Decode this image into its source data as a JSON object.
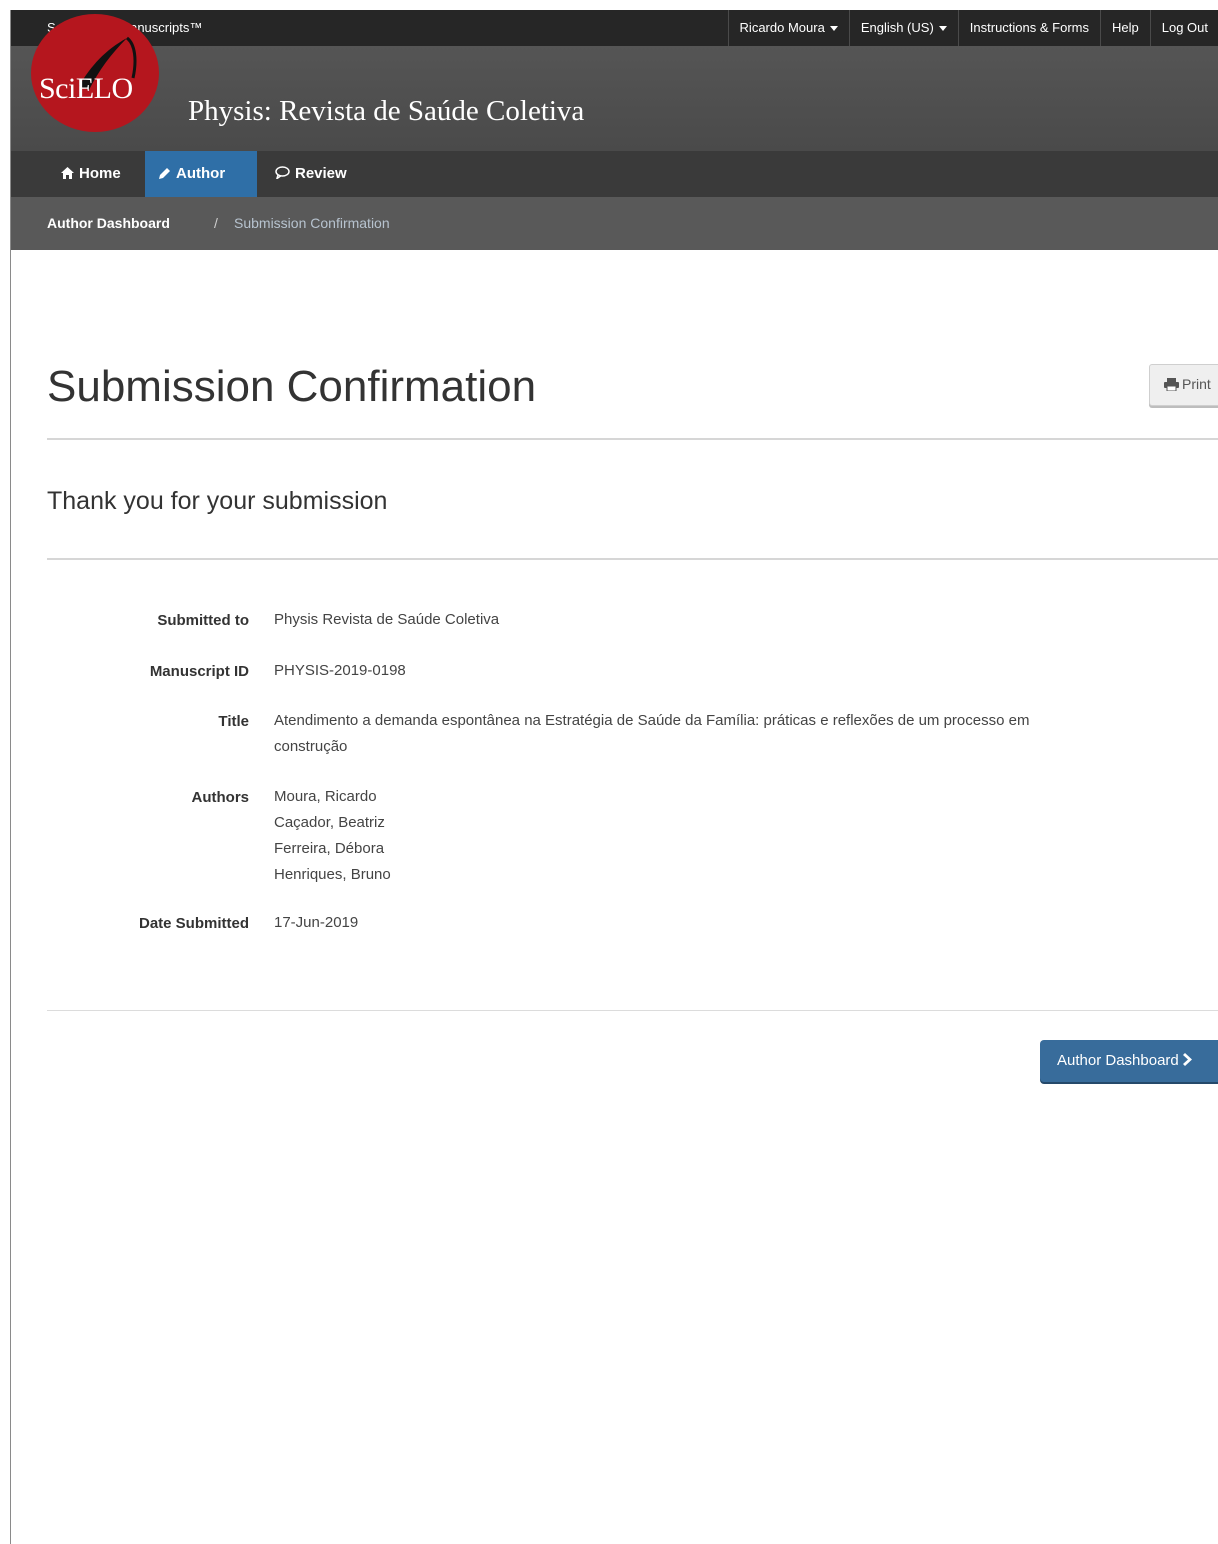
{
  "topbar": {
    "brand": "ScholarOne Manuscripts™",
    "user": "Ricardo Moura",
    "language": "English (US)",
    "instructions": "Instructions & Forms",
    "help": "Help",
    "logout": "Log Out"
  },
  "header": {
    "logo_text": "SciELO",
    "journal_title": "Physis: Revista de Saúde Coletiva"
  },
  "nav": {
    "home": "Home",
    "author": "Author",
    "review": "Review",
    "active": "Author"
  },
  "breadcrumb": {
    "link": "Author Dashboard",
    "separator": "/",
    "current": "Submission Confirmation"
  },
  "page": {
    "title": "Submission Confirmation",
    "print_label": "Print",
    "subtitle": "Thank you for your submission"
  },
  "details": {
    "submitted_to_label": "Submitted to",
    "submitted_to": "Physis Revista de Saúde Coletiva",
    "manuscript_id_label": "Manuscript ID",
    "manuscript_id": "PHYSIS-2019-0198",
    "title_label": "Title",
    "title_line1": "Atendimento a demanda espontânea na Estratégia de Saúde da Família: práticas e reflexões de um processo em",
    "title_line2": "construção",
    "authors_label": "Authors",
    "authors": [
      "Moura, Ricardo",
      "Caçador, Beatriz",
      "Ferreira, Débora",
      "Henriques, Bruno"
    ],
    "date_label": "Date Submitted",
    "date": "17-Jun-2019"
  },
  "actions": {
    "dashboard_label": "Author Dashboard"
  },
  "colors": {
    "topbar": "#262626",
    "header": "#4f4f4f",
    "nav": "#3a3a3a",
    "nav_active": "#2f6fa7",
    "breadcrumb": "#595959",
    "logo": "#b5161e",
    "primary_button": "#386c9b"
  },
  "icons": {
    "home": "home-icon",
    "author": "pencil-icon",
    "review": "comment-icon",
    "print": "printer-icon",
    "dashboard": "chevron-right-icon",
    "dropdown": "caret-down-icon"
  }
}
